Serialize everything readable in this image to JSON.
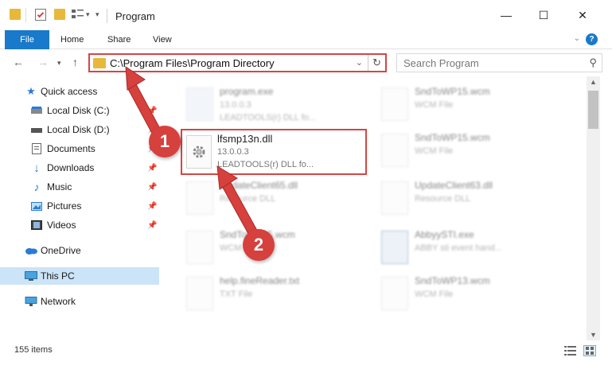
{
  "window": {
    "title": "Program",
    "minimize": "—",
    "maximize": "☐",
    "close": "✕"
  },
  "ribbon": {
    "file_tab": "File",
    "home_tab": "Home",
    "share_tab": "Share",
    "view_tab": "View",
    "help": "?"
  },
  "address": {
    "path": "C:\\Program Files\\Program Directory",
    "search_placeholder": "Search Program"
  },
  "nav": {
    "items": [
      {
        "label": "Quick access",
        "icon": "star-icon",
        "pinned": false
      },
      {
        "label": "Local Disk (C:)",
        "icon": "drive-icon",
        "pinned": true
      },
      {
        "label": "Local Disk (D:)",
        "icon": "drive-icon",
        "pinned": true
      },
      {
        "label": "Documents",
        "icon": "documents-icon",
        "pinned": true
      },
      {
        "label": "Downloads",
        "icon": "downloads-icon",
        "pinned": true
      },
      {
        "label": "Music",
        "icon": "music-icon",
        "pinned": true
      },
      {
        "label": "Pictures",
        "icon": "pictures-icon",
        "pinned": true
      },
      {
        "label": "Videos",
        "icon": "videos-icon",
        "pinned": true
      },
      {
        "label": "OneDrive",
        "icon": "onedrive-icon",
        "pinned": false
      },
      {
        "label": "This PC",
        "icon": "this-pc-icon",
        "pinned": false,
        "selected": true
      },
      {
        "label": "Network",
        "icon": "network-icon",
        "pinned": false
      }
    ]
  },
  "files": [
    {
      "name": "program.exe",
      "line1": "13.0.0.3",
      "line2": "LEADTOOLS(r) DLL fo..."
    },
    {
      "name": "SndToWP15.wcm",
      "line1": "WCM File",
      "line2": ""
    },
    {
      "name": "lfsmp13n.dll",
      "line1": "13.0.0.3",
      "line2": "LEADTOOLS(r) DLL fo..."
    },
    {
      "name": "SndToWP15.wcm",
      "line1": "WCM File",
      "line2": ""
    },
    {
      "name": "UpdateClient65.dll",
      "line1": "Resource DLL",
      "line2": ""
    },
    {
      "name": "UpdateClient63.dll",
      "line1": "Resource DLL",
      "line2": ""
    },
    {
      "name": "SndToWP15.wcm",
      "line1": "WCM File",
      "line2": ""
    },
    {
      "name": "AbbyySTI.exe",
      "line1": "ABBY sti event hand...",
      "line2": ""
    },
    {
      "name": "help.fineReader.txt",
      "line1": "TXT File",
      "line2": ""
    },
    {
      "name": "SndToWP13.wcm",
      "line1": "WCM File",
      "line2": ""
    }
  ],
  "status": {
    "count": "155 items"
  },
  "annotations": {
    "step1": "1",
    "step2": "2"
  },
  "colors": {
    "accent": "#1979ca",
    "highlight": "#d64545",
    "badge": "#d6403d",
    "selected": "#cce4f7"
  }
}
